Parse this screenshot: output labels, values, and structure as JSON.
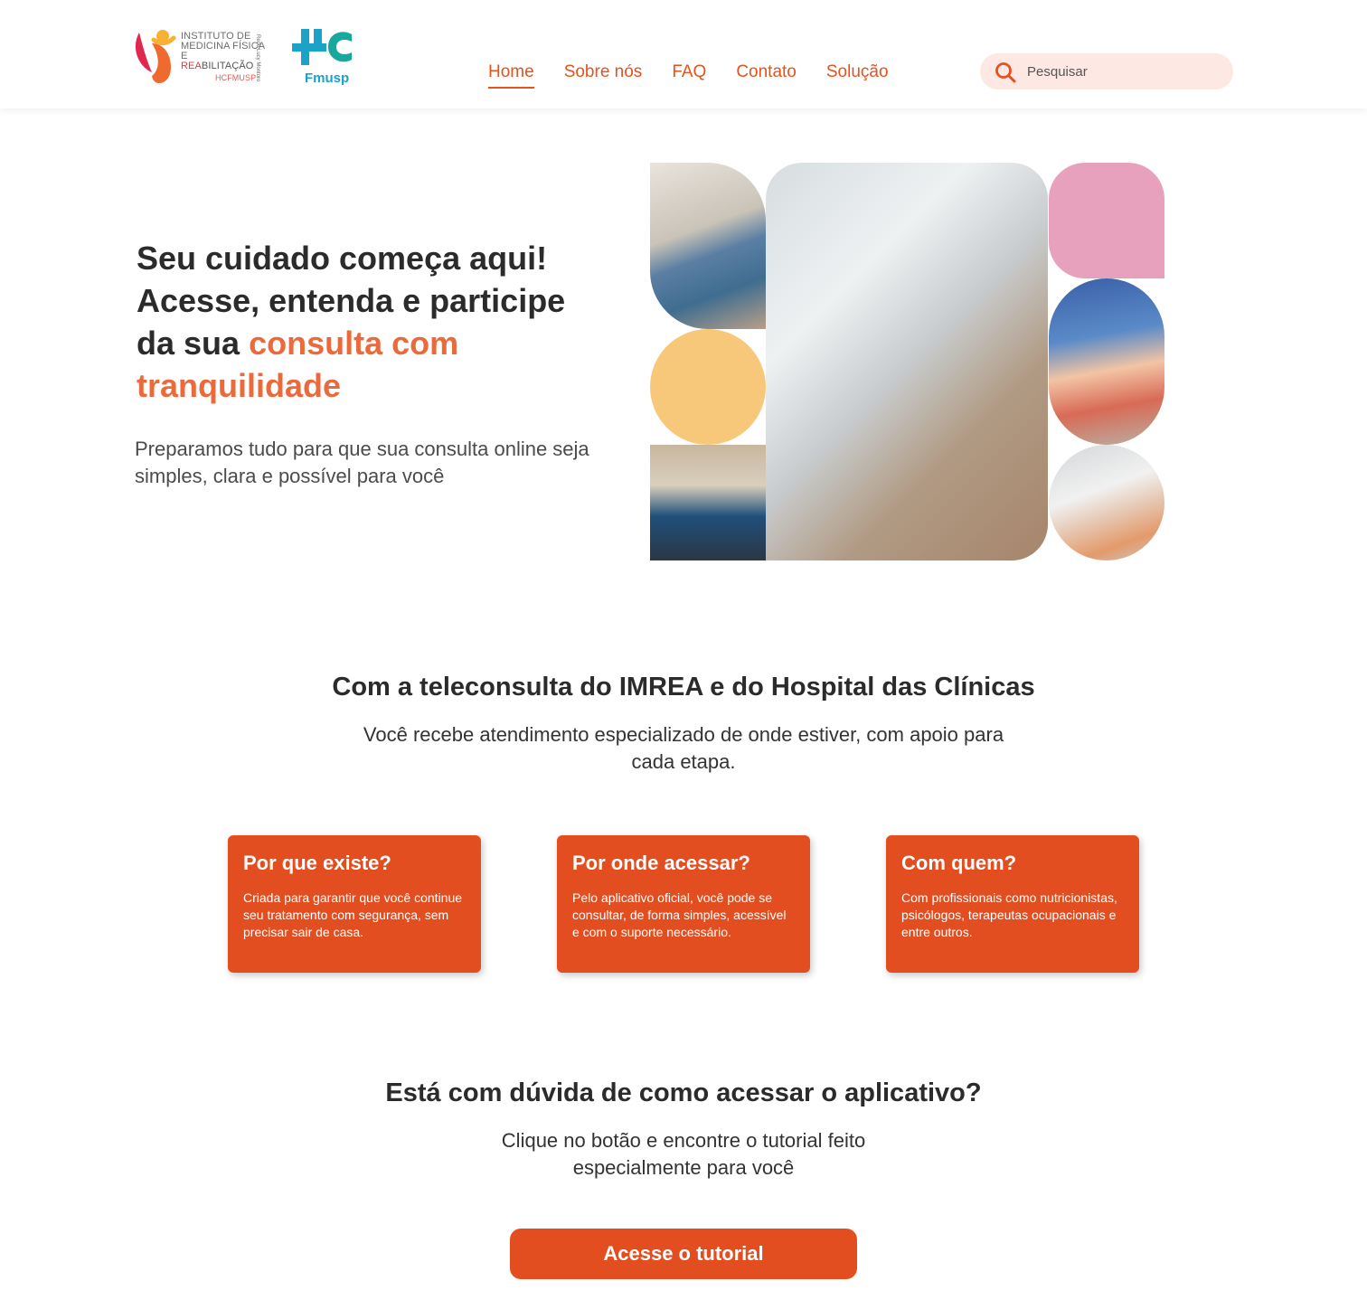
{
  "header": {
    "logo_imrea": {
      "line1": "INSTITUTO DE",
      "line2": "MEDICINA FÍSICA E",
      "line3_strong": "REA",
      "line3_rest": "BILITAÇÃO",
      "line4": "HCFMUSP",
      "vertical": "Rede Lucy Montoro"
    },
    "logo_hc": {
      "label": "Fmusp"
    },
    "nav": [
      {
        "label": "Home",
        "active": true
      },
      {
        "label": "Sobre nós",
        "active": false
      },
      {
        "label": "FAQ",
        "active": false
      },
      {
        "label": "Contato",
        "active": false
      },
      {
        "label": "Solução",
        "active": false
      }
    ],
    "search": {
      "placeholder": "Pesquisar",
      "value": ""
    }
  },
  "hero": {
    "title_part1": "Seu cuidado começa aqui! Acesse, entenda e participe da sua ",
    "title_accent": "consulta com tranquilidade",
    "subtitle": "Preparamos tudo para que sua consulta online seja simples, clara e possível para você"
  },
  "teleconsulta": {
    "title": "Com a teleconsulta do IMREA e do Hospital das Clínicas",
    "subtitle": "Você recebe atendimento especializado de onde estiver, com apoio para cada etapa.",
    "cards": [
      {
        "title": "Por que existe?",
        "text": "Criada para garantir que você continue seu tratamento com segurança, sem precisar sair de casa."
      },
      {
        "title": "Por onde acessar?",
        "text": "Pelo aplicativo oficial, você pode se consultar, de forma simples, acessível e com o suporte necessário."
      },
      {
        "title": "Com quem?",
        "text": "Com profissionais como nutricionistas, psicólogos, terapeutas ocupacionais e entre outros."
      }
    ]
  },
  "tutorial": {
    "title": "Está com dúvida de como acessar o aplicativo?",
    "subtitle": "Clique no botão e encontre o tutorial feito especialmente para você",
    "button_label": "Acesse o tutorial"
  },
  "colors": {
    "accent": "#e34e20",
    "accent_light": "#ea6a3b",
    "search_bg": "#fde8e3",
    "tile_yellow": "#f8c87a",
    "tile_pink": "#e8a1bd"
  }
}
